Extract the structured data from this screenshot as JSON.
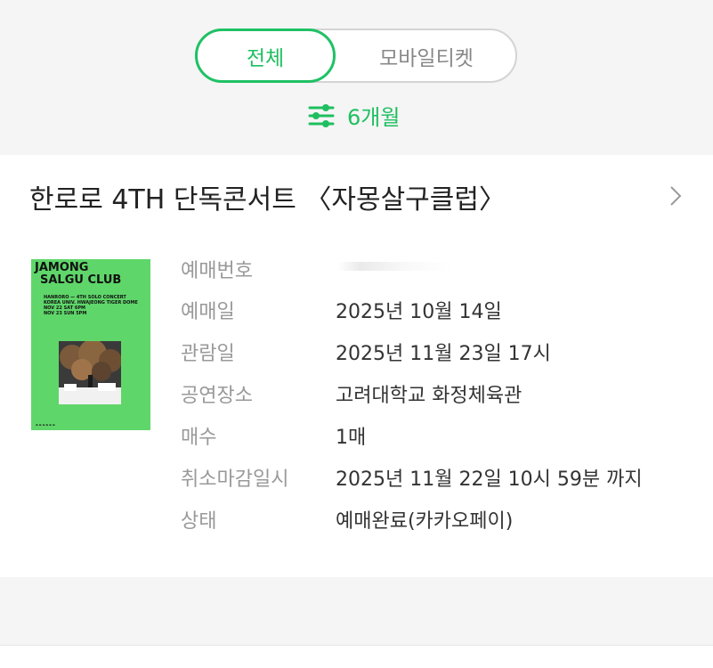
{
  "tabs": {
    "active_label": "전체",
    "other_label": "모바일티켓"
  },
  "filter": {
    "label": "6개월",
    "icon": "sliders-icon",
    "color": "#1fbf60"
  },
  "booking": {
    "title": "한로로 4TH 단독콘서트 〈자몽살구클럽〉",
    "poster": {
      "title_line1": "JAMONG",
      "title_line2": "SALGU CLUB",
      "subtitle": "HANRORO — 4TH SOLO CONCERT\nKOREA UNIV. HWAJEONG TIGER DOME\nNOV 22 SAT 6PM\nNOV 23 SUN 5PM"
    },
    "rows": [
      {
        "label": "예매번호",
        "value": ""
      },
      {
        "label": "예매일",
        "value": "2025년 10월 14일"
      },
      {
        "label": "관람일",
        "value": "2025년 11월 23일 17시"
      },
      {
        "label": "공연장소",
        "value": "고려대학교 화정체육관"
      },
      {
        "label": "매수",
        "value": "1매"
      },
      {
        "label": "취소마감일시",
        "value": "2025년 11월 22일 10시 59분 까지"
      },
      {
        "label": "상태",
        "value": "예매완료(카카오페이)"
      }
    ]
  }
}
